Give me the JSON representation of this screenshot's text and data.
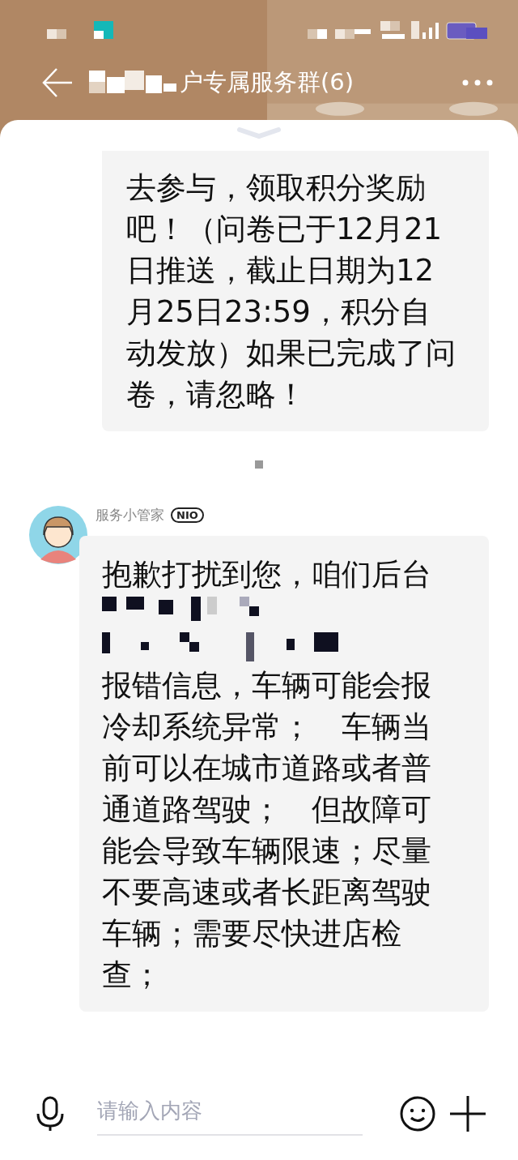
{
  "header": {
    "title": "户专属服务群(6)"
  },
  "messages": [
    {
      "kind": "plain",
      "text": "去参与，领取积分奖励吧！（问卷已于12月21日推送，截止日期为12月25日23:59，积分自动发放）如果已完成了问卷，请忽略！"
    },
    {
      "kind": "redacted",
      "sender": "服务小管家",
      "badge": "NIO",
      "text_before": "抱歉打扰到您，咱们后台",
      "text_after": "报错信息，车辆可能会报冷却系统异常；　车辆当前可以在城市道路或者普通道路驾驶；　但故障可能会导致车辆限速；尽量不要高速或者长距离驾驶车辆；需要尽快进店检查；"
    }
  ],
  "input": {
    "placeholder": "请输入内容"
  }
}
